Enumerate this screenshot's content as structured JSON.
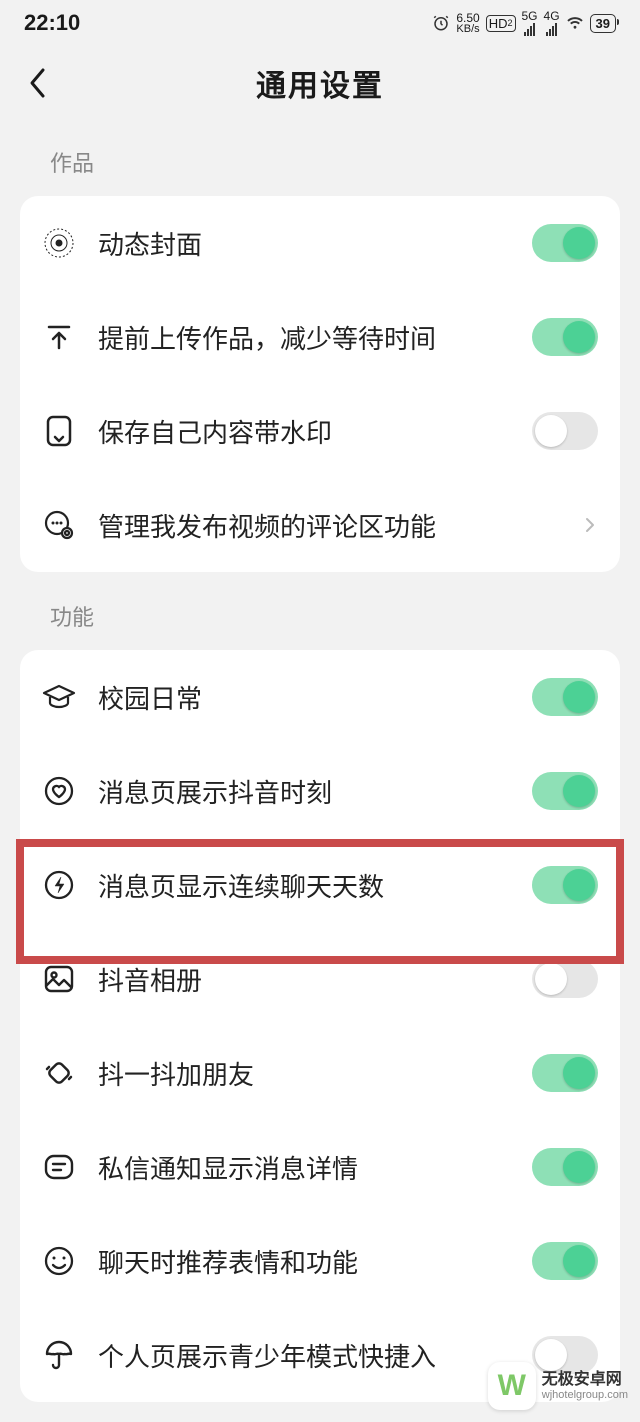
{
  "status": {
    "time": "22:10",
    "net_speed_top": "6.50",
    "net_speed_bot": "KB/s",
    "hd_label": "HD",
    "hd_sub": "2",
    "fiveg": "5G",
    "fourg": "4G",
    "battery": "39"
  },
  "header": {
    "title": "通用设置"
  },
  "section1": {
    "title": "作品",
    "items": [
      {
        "label": "动态封面",
        "toggle": true
      },
      {
        "label": "提前上传作品，减少等待时间",
        "toggle": true
      },
      {
        "label": "保存自己内容带水印",
        "toggle": false
      },
      {
        "label": "管理我发布视频的评论区功能",
        "nav": true
      }
    ]
  },
  "section2": {
    "title": "功能",
    "items": [
      {
        "label": "校园日常",
        "toggle": true
      },
      {
        "label": "消息页展示抖音时刻",
        "toggle": true
      },
      {
        "label": "消息页显示连续聊天天数",
        "toggle": true
      },
      {
        "label": "抖音相册",
        "toggle": false
      },
      {
        "label": "抖一抖加朋友",
        "toggle": true
      },
      {
        "label": "私信通知显示消息详情",
        "toggle": true
      },
      {
        "label": "聊天时推荐表情和功能",
        "toggle": true
      },
      {
        "label": "个人页展示青少年模式快捷入",
        "toggle": false
      }
    ]
  },
  "watermark": {
    "logo_letter": "W",
    "name": "无极安卓网",
    "url": "wjhotelgroup.com"
  }
}
